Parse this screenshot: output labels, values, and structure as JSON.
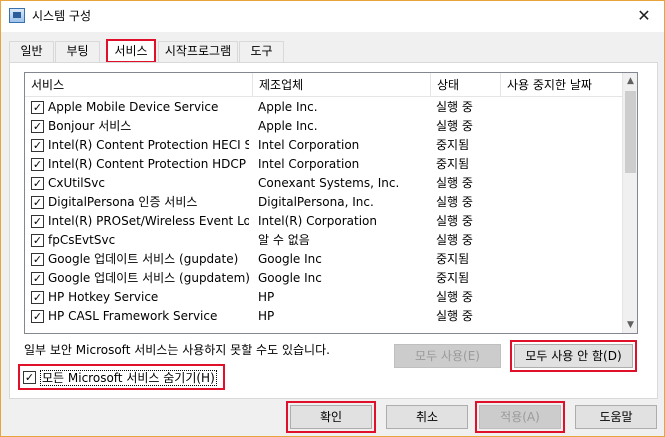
{
  "window": {
    "title": "시스템 구성",
    "close_glyph": "✕"
  },
  "tabs": [
    {
      "label": "일반"
    },
    {
      "label": "부팅"
    },
    {
      "label": "서비스"
    },
    {
      "label": "시작프로그램"
    },
    {
      "label": "도구"
    }
  ],
  "columns": [
    "서비스",
    "제조업체",
    "상태",
    "사용 중지한 날짜"
  ],
  "rows": [
    {
      "name": "Apple Mobile Device Service",
      "vendor": "Apple Inc.",
      "status": "실행 중",
      "checked": true
    },
    {
      "name": "Bonjour 서비스",
      "vendor": "Apple Inc.",
      "status": "실행 중",
      "checked": true
    },
    {
      "name": "Intel(R) Content Protection HECI Se...",
      "vendor": "Intel Corporation",
      "status": "중지됨",
      "checked": true
    },
    {
      "name": "Intel(R) Content Protection HDCP S...",
      "vendor": "Intel Corporation",
      "status": "중지됨",
      "checked": true
    },
    {
      "name": "CxUtilSvc",
      "vendor": "Conexant Systems, Inc.",
      "status": "실행 중",
      "checked": true
    },
    {
      "name": "DigitalPersona 인증 서비스",
      "vendor": "DigitalPersona, Inc.",
      "status": "실행 중",
      "checked": true
    },
    {
      "name": "Intel(R) PROSet/Wireless Event Log",
      "vendor": "Intel(R) Corporation",
      "status": "실행 중",
      "checked": true
    },
    {
      "name": "fpCsEvtSvc",
      "vendor": "알 수 없음",
      "status": "실행 중",
      "checked": true
    },
    {
      "name": "Google 업데이트 서비스 (gupdate)",
      "vendor": "Google Inc",
      "status": "중지됨",
      "checked": true
    },
    {
      "name": "Google 업데이트 서비스 (gupdatem)",
      "vendor": "Google Inc",
      "status": "중지됨",
      "checked": true
    },
    {
      "name": "HP Hotkey Service",
      "vendor": "HP",
      "status": "실행 중",
      "checked": true
    },
    {
      "name": "HP CASL Framework Service",
      "vendor": "HP",
      "status": "실행 중",
      "checked": true
    }
  ],
  "note": "일부 보안 Microsoft 서비스는 사용하지 못할 수도 있습니다.",
  "buttons": {
    "enable_all": "모두 사용(E)",
    "disable_all": "모두 사용 안 함(D)",
    "hide_ms": "모든 Microsoft 서비스 숨기기(H)",
    "ok": "확인",
    "cancel": "취소",
    "apply": "적용(A)",
    "help": "도움말"
  },
  "check_glyph": "✓",
  "accent_color": "#e0102a",
  "icons": [
    "system-config-app-icon",
    "close-icon",
    "checkbox-checked-icon",
    "scroll-up-arrow-icon",
    "scroll-down-arrow-icon"
  ]
}
